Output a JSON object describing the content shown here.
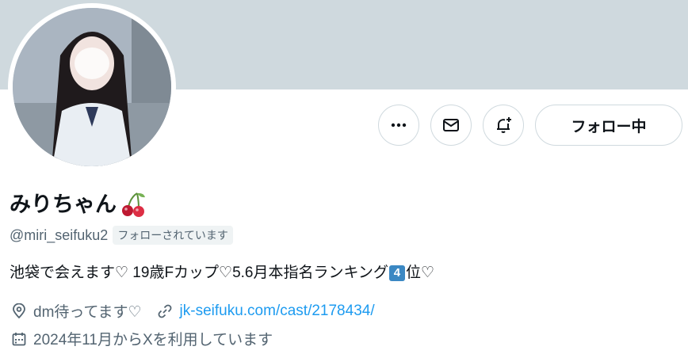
{
  "profile": {
    "display_name": "みりちゃん",
    "handle": "@miri_seifuku2",
    "follows_you": "フォローされています",
    "bio_before": "池袋で会えます♡ 19歳Fカップ♡5.6月本指名ランキング",
    "bio_rank": "4",
    "bio_after": "位♡",
    "location": "dm待ってます♡",
    "website": "jk-seifuku.com/cast/2178434/",
    "joined": "2024年11月からXを利用しています"
  },
  "actions": {
    "follow_label": "フォロー中",
    "more_icon": "more-icon",
    "message_icon": "mail-icon",
    "notify_icon": "bell-plus-icon"
  },
  "colors": {
    "banner": "#cfd9de",
    "link": "#1d9bf0",
    "secondary_text": "#536471",
    "keycap": "#3b88c3"
  }
}
